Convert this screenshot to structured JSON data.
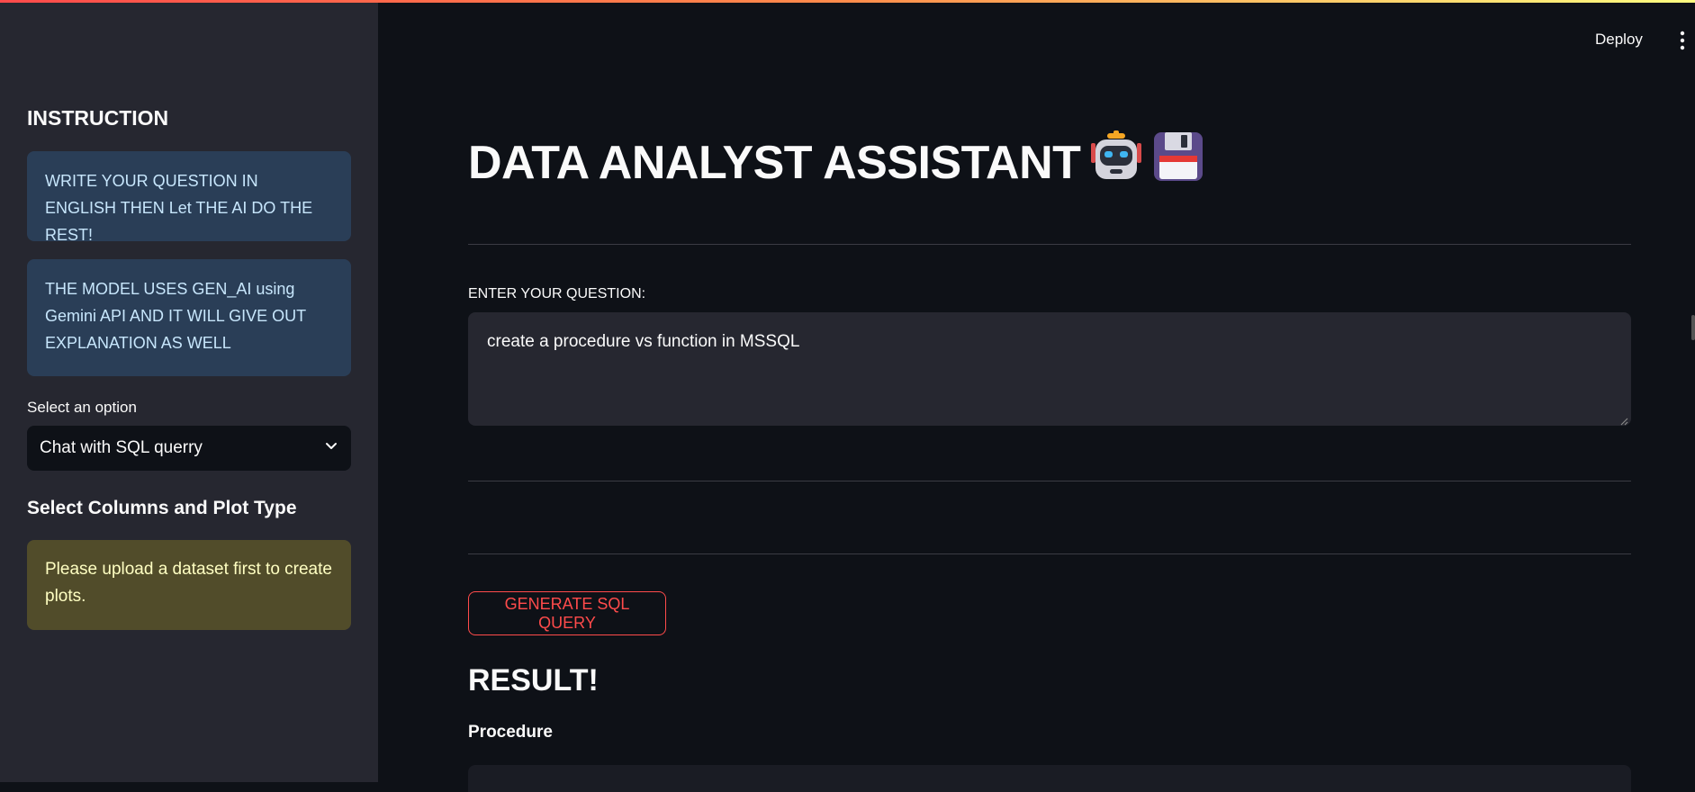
{
  "header": {
    "deploy_label": "Deploy",
    "menu_icon": "kebab-menu-icon"
  },
  "sidebar": {
    "heading": "INSTRUCTION",
    "info_1": "WRITE YOUR QUESTION IN ENGLISH THEN Let THE AI DO THE REST!",
    "info_2": "THE MODEL USES GEN_AI using Gemini API AND IT WILL GIVE OUT EXPLANATION AS WELL",
    "select_label": "Select an option",
    "select_value": "Chat with SQL querry",
    "subheading": "Select Columns and Plot Type",
    "warning": "Please upload a dataset first to create plots."
  },
  "main": {
    "title": "DATA ANALYST ASSISTANT",
    "title_icons": [
      "robot-icon",
      "floppy-disk-icon"
    ],
    "question_label": "ENTER YOUR QUESTION:",
    "question_value": "create a procedure vs function in MSSQL",
    "generate_button": "GENERATE SQL QUERY",
    "result_heading": "RESULT!",
    "procedure_label": "Procedure"
  },
  "colors": {
    "accent": "#ff4b4b",
    "background": "#0e1117",
    "sidebar_bg": "#262730"
  }
}
